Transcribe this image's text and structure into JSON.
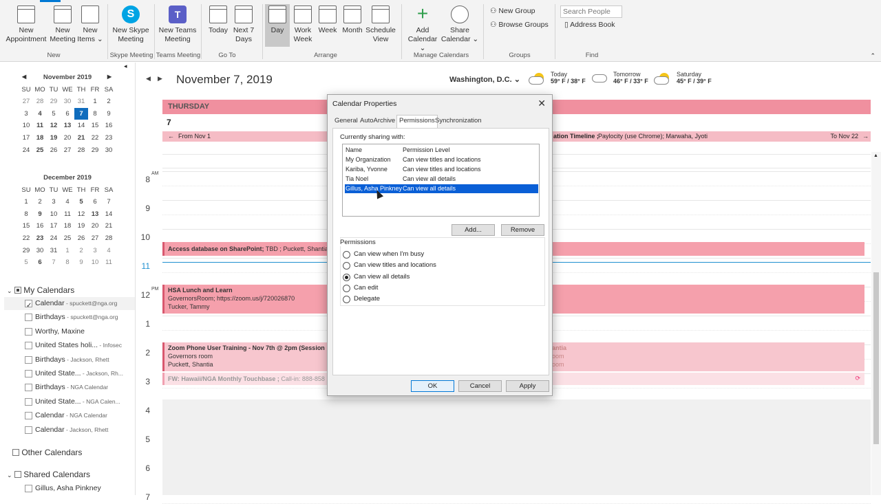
{
  "ribbon": {
    "new_appointment": "New Appointment",
    "new_meeting": "New Meeting",
    "new_items": "New Items ⌄",
    "new_skype": "New Skype Meeting",
    "new_teams": "New Teams Meeting",
    "today": "Today",
    "next7": "Next 7 Days",
    "day": "Day",
    "work_week": "Work Week",
    "week": "Week",
    "month": "Month",
    "schedule_view": "Schedule View",
    "add_calendar": "Add Calendar ⌄",
    "share_calendar": "Share Calendar ⌄",
    "new_group": "New Group",
    "browse_groups": "Browse Groups",
    "search_placeholder": "Search People",
    "address_book": "Address Book",
    "groups": {
      "new": "New",
      "skype": "Skype Meeting",
      "teams": "Teams Meeting",
      "goto": "Go To",
      "arrange": "Arrange",
      "manage": "Manage Calendars",
      "groups": "Groups",
      "find": "Find"
    }
  },
  "nav": {
    "nov": {
      "title": "November 2019",
      "dow": [
        "SU",
        "MO",
        "TU",
        "WE",
        "TH",
        "FR",
        "SA"
      ],
      "weeks": [
        [
          "27",
          "28",
          "29",
          "30",
          "31",
          "1",
          "2"
        ],
        [
          "3",
          "4",
          "5",
          "6",
          "7",
          "8",
          "9"
        ],
        [
          "10",
          "11",
          "12",
          "13",
          "14",
          "15",
          "16"
        ],
        [
          "17",
          "18",
          "19",
          "20",
          "21",
          "22",
          "23"
        ],
        [
          "24",
          "25",
          "26",
          "27",
          "28",
          "29",
          "30"
        ]
      ]
    },
    "dec": {
      "title": "December 2019",
      "dow": [
        "SU",
        "MO",
        "TU",
        "WE",
        "TH",
        "FR",
        "SA"
      ],
      "weeks": [
        [
          "1",
          "2",
          "3",
          "4",
          "5",
          "6",
          "7"
        ],
        [
          "8",
          "9",
          "10",
          "11",
          "12",
          "13",
          "14"
        ],
        [
          "15",
          "16",
          "17",
          "18",
          "19",
          "20",
          "21"
        ],
        [
          "22",
          "23",
          "24",
          "25",
          "26",
          "27",
          "28"
        ],
        [
          "29",
          "30",
          "31",
          "1",
          "2",
          "3",
          "4"
        ],
        [
          "5",
          "6",
          "7",
          "8",
          "9",
          "10",
          "11"
        ]
      ]
    },
    "my_calendars": "My Calendars",
    "items": [
      {
        "name": "Calendar",
        "sub": " - spuckett@nga.org"
      },
      {
        "name": "Birthdays",
        "sub": " - spuckett@nga.org"
      },
      {
        "name": "Worthy, Maxine",
        "sub": ""
      },
      {
        "name": "United States holi...",
        "sub": " - Infosec"
      },
      {
        "name": "Birthdays",
        "sub": " - Jackson, Rhett"
      },
      {
        "name": "United State...",
        "sub": " - Jackson, Rh..."
      },
      {
        "name": "Birthdays",
        "sub": " - NGA Calendar"
      },
      {
        "name": "United State...",
        "sub": " - NGA Calen..."
      },
      {
        "name": "Calendar",
        "sub": " - NGA Calendar"
      },
      {
        "name": "Calendar",
        "sub": " - Jackson, Rhett"
      }
    ],
    "other_calendars": "Other Calendars",
    "shared_calendars": "Shared Calendars",
    "shared_item": "Gillus, Asha Pinkney"
  },
  "view": {
    "date": "November 7, 2019",
    "location": "Washington, D.C.  ⌄",
    "weather": [
      {
        "label": "Today",
        "temp": "59° F / 38° F"
      },
      {
        "label": "Tomorrow",
        "temp": "46° F / 33° F"
      },
      {
        "label": "Saturday",
        "temp": "45° F / 39° F"
      }
    ],
    "dayname": "THURSDAY",
    "daynum": "7",
    "allday_from": "From Nov 1",
    "allday_title": "ation Timeline ;",
    "allday_rest": " Paylocity (use Chrome); Marwaha, Jyoti",
    "allday_to": "To Nov 22",
    "hours": [
      "8",
      "9",
      "10",
      "11",
      "12",
      "1",
      "2",
      "3",
      "4",
      "5",
      "6",
      "7"
    ],
    "am": "AM",
    "pm": "PM",
    "events": [
      {
        "title": "Access database on SharePoint;",
        "rest": " TBD ; Puckett, Shantia"
      },
      {
        "title": "HSA Lunch and Learn",
        "l2": "GovernorsRoom; https://zoom.us/j/720026870",
        "l3": "Tucker, Tammy"
      },
      {
        "title": "Zoom Phone User Training - Nov 7th @ 2pm (Session",
        "l2": "Governors room",
        "l3": "Puckett, Shantia",
        "r1": "antia",
        "r2": "oom",
        "r3": "oom"
      },
      {
        "title": "FW: Hawaii/NGA Monthly Touchbase ;",
        "rest": " Call-in: 888-858"
      }
    ]
  },
  "dialog": {
    "title": "Calendar Properties",
    "tabs": [
      "General",
      "AutoArchive",
      "Permissions",
      "Synchronization"
    ],
    "sharing_label": "Currently sharing with:",
    "col_name": "Name",
    "col_level": "Permission Level",
    "rows": [
      {
        "name": "My Organization",
        "level": "Can view titles and locations"
      },
      {
        "name": "Kariba, Yvonne",
        "level": "Can view titles and locations"
      },
      {
        "name": "Tia Noel",
        "level": "Can view all details"
      },
      {
        "name": "Gillus, Asha Pinkney",
        "level": "Can view all details"
      }
    ],
    "add": "Add...",
    "remove": "Remove",
    "permissions_label": "Permissions",
    "options": [
      "Can view when I'm busy",
      "Can view titles and locations",
      "Can view all details",
      "Can edit",
      "Delegate"
    ],
    "ok": "OK",
    "cancel": "Cancel",
    "apply": "Apply"
  }
}
